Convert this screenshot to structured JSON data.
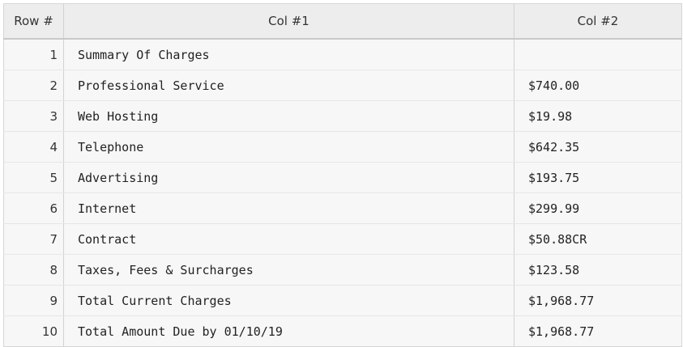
{
  "table": {
    "headers": [
      "Row #",
      "Col #1",
      "Col #2"
    ],
    "rows": [
      {
        "num": "1",
        "col1": "Summary Of Charges",
        "col2": ""
      },
      {
        "num": "2",
        "col1": "Professional Service",
        "col2": "$740.00"
      },
      {
        "num": "3",
        "col1": "Web Hosting",
        "col2": "$19.98"
      },
      {
        "num": "4",
        "col1": "Telephone",
        "col2": "$642.35"
      },
      {
        "num": "5",
        "col1": "Advertising",
        "col2": "$193.75"
      },
      {
        "num": "6",
        "col1": "Internet",
        "col2": "$299.99"
      },
      {
        "num": "7",
        "col1": "Contract",
        "col2": "$50.88CR"
      },
      {
        "num": "8",
        "col1": "Taxes, Fees & Surcharges",
        "col2": "$123.58"
      },
      {
        "num": "9",
        "col1": "Total Current Charges",
        "col2": "$1,968.77"
      },
      {
        "num": "10",
        "col1": "Total Amount Due by 01/10/19",
        "col2": "$1,968.77"
      }
    ]
  }
}
